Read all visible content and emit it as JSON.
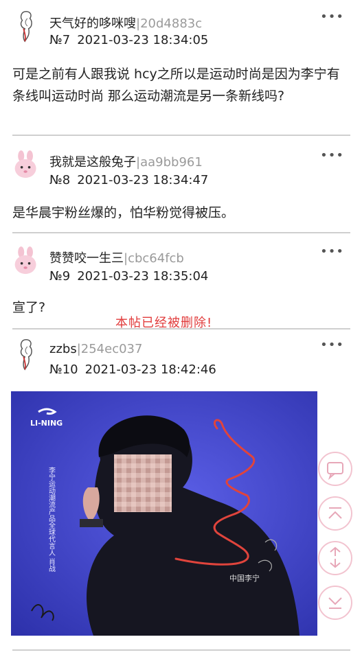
{
  "posts": [
    {
      "username": "天气好的哆咪嗖",
      "uid": "20d4883c",
      "floor": "№7",
      "datetime": "2021-03-23 18:34:05",
      "content": "可是之前有人跟我说 hcy之所以是运动时尚是因为李宁有条线叫运动时尚 那么运动潮流是另一条新线吗?",
      "avatar_icon": "sketch-figure-avatar"
    },
    {
      "username": "我就是这般兔子",
      "uid": "aa9bb961",
      "floor": "№8",
      "datetime": "2021-03-23 18:34:47",
      "content": "是华晨宇粉丝爆的，怕华粉觉得被压。",
      "avatar_icon": "pink-bunny-avatar"
    },
    {
      "username": "赞赞咬一生三",
      "uid": "cbc64fcb",
      "floor": "№9",
      "datetime": "2021-03-23 18:35:04",
      "content": "宣了?",
      "avatar_icon": "pink-bunny-avatar"
    },
    {
      "username": "zzbs",
      "uid": "254ec037",
      "floor": "№10",
      "datetime": "2021-03-23 18:42:46",
      "content": "",
      "avatar_icon": "sketch-figure-avatar"
    }
  ],
  "separator": "|",
  "more_label": "•••",
  "deleted_notice": "本帖已经被删除!",
  "image": {
    "brand": "LI-NING",
    "vertical_text": "李宁运动潮流产品全球代言人 肖战",
    "jacket_text": "中国李宁"
  },
  "fab_buttons": [
    "comment-icon",
    "scroll-top-icon",
    "refresh-icon",
    "scroll-bottom-icon"
  ],
  "colors": {
    "deleted": "#e13b3b",
    "uid": "#9a9a9a",
    "photo_bg": "#3a3ec8",
    "fab_border": "#f2c3cf"
  }
}
